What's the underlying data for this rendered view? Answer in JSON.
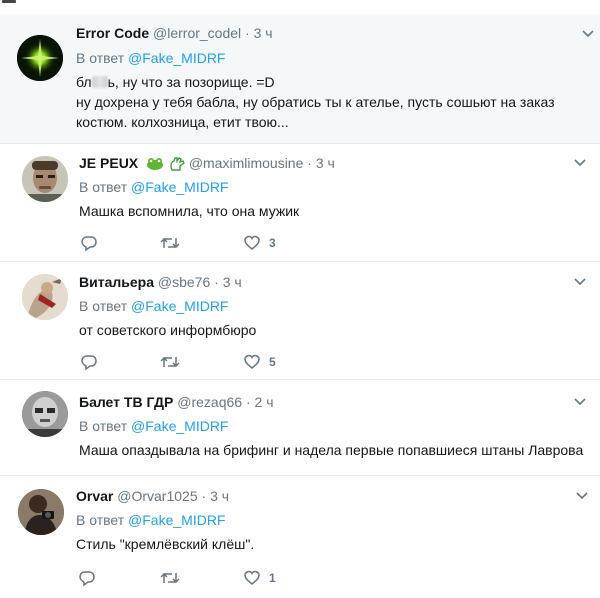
{
  "colors": {
    "link": "#1da1f2",
    "muted": "#657786",
    "text": "#14171a",
    "highlight_bg": "#f5f8fa",
    "divider": "#e6ecf0"
  },
  "tweets": [
    {
      "name": "Error Code",
      "handle": "@lerror_codel",
      "dot": "·",
      "time": "3 ч",
      "reply_prefix": "В ответ",
      "reply_to": "@Fake_MIDRF",
      "text_part1": "бл",
      "text_part2": "ь, ну что за позорище. =D",
      "text_line2": "ну дохрена у тебя бабла, ну обратись ты к ателье, пусть сошьют на заказ",
      "text_line3": "костюм. колхозница, етит твою...",
      "avatar_icon": "green-star-icon"
    },
    {
      "name": "JE PEUX",
      "handle": "@maximlimousine",
      "dot": "·",
      "time": "3 ч",
      "reply_prefix": "В ответ",
      "reply_to": "@Fake_MIDRF",
      "text": "Машка вспомнила, что она мужик",
      "likes": "3",
      "name_badge_icons": [
        "frog-face-icon",
        "green-hand-icon"
      ],
      "avatar_icon": "man-face-icon"
    },
    {
      "name": "Витальера",
      "handle": "@sbe76",
      "dot": "·",
      "time": "3 ч",
      "reply_prefix": "В ответ",
      "reply_to": "@Fake_MIDRF",
      "text": "от советского информбюро",
      "likes": "5",
      "avatar_icon": "painting-icon"
    },
    {
      "name": "Балет ТВ ГДР",
      "handle": "@rezaq66",
      "dot": "·",
      "time": "2 ч",
      "reply_prefix": "В ответ",
      "reply_to": "@Fake_MIDRF",
      "text": "Маша опаздывала на брифинг и надела первые попавшиеся штаны Лаврова",
      "avatar_icon": "grayscale-face-icon"
    },
    {
      "name": "Orvar",
      "handle": "@Orvar1025",
      "dot": "·",
      "time": "3 ч",
      "reply_prefix": "В ответ",
      "reply_to": "@Fake_MIDRF",
      "text": "Стиль \"кремлёвский клёш\".",
      "likes": "1",
      "avatar_icon": "photographer-icon"
    }
  ]
}
